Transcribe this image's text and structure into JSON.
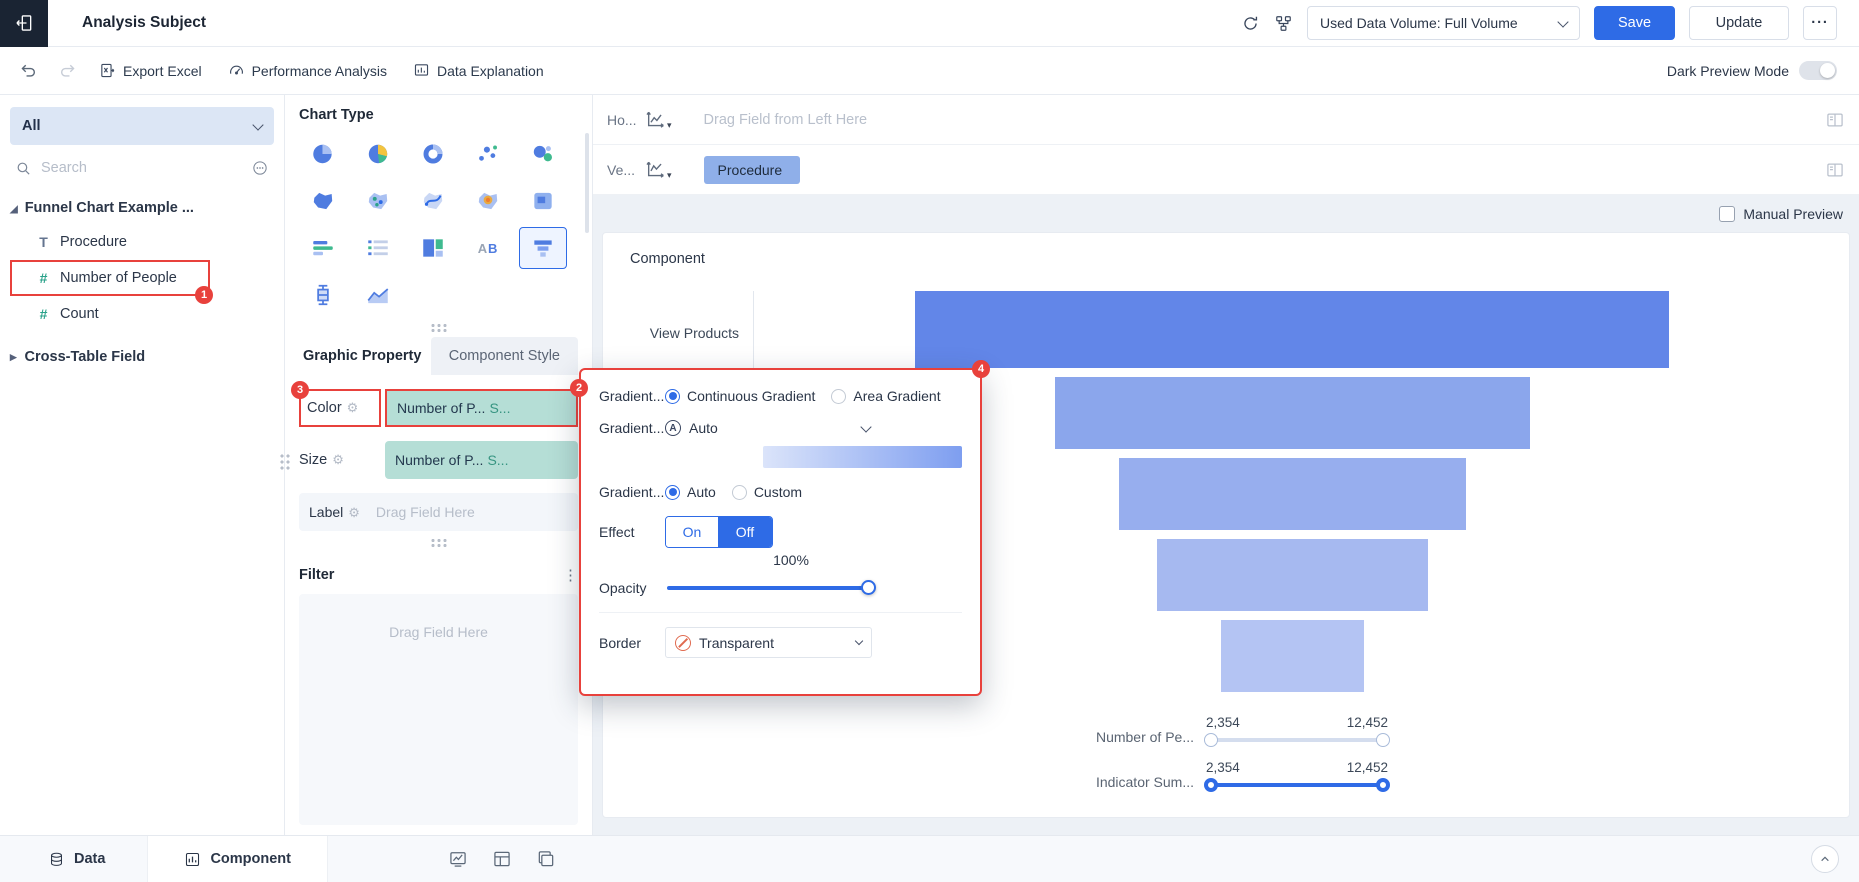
{
  "colors": {
    "accent_blue": "#2e6be6",
    "annotation_red": "#e8413c",
    "pill_teal": "#b5ded6",
    "pill_blue": "#8fafe9",
    "topbar_dark": "#1a2433"
  },
  "topbar": {
    "title": "Analysis Subject",
    "volume_select": "Used Data Volume: Full Volume",
    "save_label": "Save",
    "update_label": "Update",
    "more_label": "···"
  },
  "toolbar": {
    "export_excel": "Export Excel",
    "performance_analysis": "Performance Analysis",
    "data_explanation": "Data Explanation",
    "dark_preview_mode": "Dark Preview Mode"
  },
  "sidebar": {
    "scope_select": "All",
    "search_placeholder": "Search",
    "root_node": "Funnel Chart Example ...",
    "fields": [
      {
        "icon": "T",
        "label": "Procedure"
      },
      {
        "icon": "#",
        "label": "Number of People",
        "badge": "1"
      },
      {
        "icon": "#",
        "label": "Count"
      }
    ],
    "collapsed_node": "Cross-Table Field"
  },
  "chart_panel": {
    "title": "Chart Type",
    "tab_active": "Graphic Property",
    "tab_inactive": "Component Style",
    "color_row": {
      "label": "Color",
      "pill_main": "Number of P...",
      "pill_suffix": "S...",
      "label_badge": "3",
      "pill_badge": "2"
    },
    "size_row": {
      "label": "Size",
      "pill_main": "Number of P...",
      "pill_suffix": "S..."
    },
    "label_row": {
      "label": "Label",
      "placeholder": "Drag Field Here"
    },
    "filter": {
      "title": "Filter",
      "placeholder": "Drag Field Here"
    }
  },
  "popup": {
    "badge": "4",
    "gradient_type": {
      "label": "Gradient...",
      "options": [
        "Continuous Gradient",
        "Area Gradient"
      ],
      "selected": "Continuous Gradient"
    },
    "gradient_scheme": {
      "label": "Gradient...",
      "value": "Auto"
    },
    "gradient_colors": [
      "#dbe4fa",
      "#7e9ef0"
    ],
    "gradient_mode": {
      "label": "Gradient...",
      "options": [
        "Auto",
        "Custom"
      ],
      "selected": "Auto"
    },
    "effect": {
      "label": "Effect",
      "on": "On",
      "off": "Off",
      "selected": "Off",
      "value": "100%"
    },
    "opacity": {
      "label": "Opacity"
    },
    "border": {
      "label": "Border",
      "value": "Transparent"
    }
  },
  "shelves": {
    "horizontal": {
      "label": "Ho...",
      "placeholder": "Drag Field from Left Here"
    },
    "vertical": {
      "label": "Ve...",
      "pill": "Procedure"
    },
    "manual_preview": "Manual Preview"
  },
  "canvas": {
    "component_title": "Component",
    "range_sliders": [
      {
        "label": "Number of Pe...",
        "min": "2,354",
        "max": "12,452"
      },
      {
        "label": "Indicator Sum...",
        "min": "2,354",
        "max": "12,452"
      }
    ]
  },
  "chart_data": {
    "type": "funnel",
    "stages": [
      {
        "label": "View Products",
        "width_pct": 100,
        "color": "#6286e8"
      },
      {
        "label": "",
        "width_pct": 63,
        "color": "#8ba6ec"
      },
      {
        "label": "",
        "width_pct": 46,
        "color": "#97aeee"
      },
      {
        "label": "",
        "width_pct": 36,
        "color": "#a6b9f0"
      },
      {
        "label": "",
        "width_pct": 19,
        "color": "#b4c4f3"
      }
    ],
    "value_range": [
      "2,354",
      "12,452"
    ]
  },
  "bottombar": {
    "tab_data": "Data",
    "tab_component": "Component"
  }
}
